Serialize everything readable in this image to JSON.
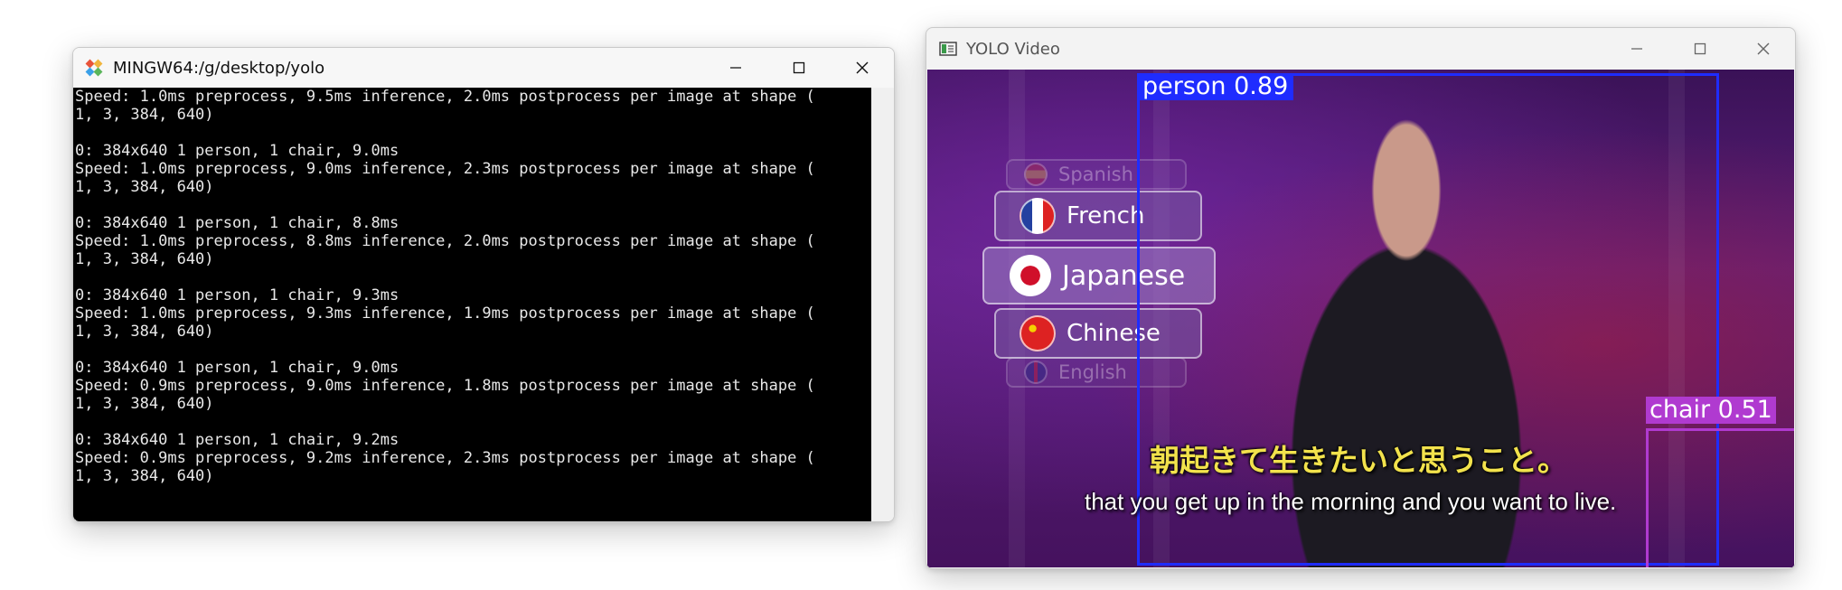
{
  "terminal": {
    "title": "MINGW64:/g/desktop/yolo",
    "lines": [
      "Speed: 1.0ms preprocess, 9.5ms inference, 2.0ms postprocess per image at shape (",
      "1, 3, 384, 640)",
      "",
      "0: 384x640 1 person, 1 chair, 9.0ms",
      "Speed: 1.0ms preprocess, 9.0ms inference, 2.3ms postprocess per image at shape (",
      "1, 3, 384, 640)",
      "",
      "0: 384x640 1 person, 1 chair, 8.8ms",
      "Speed: 1.0ms preprocess, 8.8ms inference, 2.0ms postprocess per image at shape (",
      "1, 3, 384, 640)",
      "",
      "0: 384x640 1 person, 1 chair, 9.3ms",
      "Speed: 1.0ms preprocess, 9.3ms inference, 1.9ms postprocess per image at shape (",
      "1, 3, 384, 640)",
      "",
      "0: 384x640 1 person, 1 chair, 9.0ms",
      "Speed: 0.9ms preprocess, 9.0ms inference, 1.8ms postprocess per image at shape (",
      "1, 3, 384, 640)",
      "",
      "0: 384x640 1 person, 1 chair, 9.2ms",
      "Speed: 0.9ms preprocess, 9.2ms inference, 2.3ms postprocess per image at shape (",
      "1, 3, 384, 640)"
    ],
    "icon": "git-bash-icon"
  },
  "video": {
    "title": "YOLO Video",
    "icon": "opencv-window-icon",
    "detections": {
      "person": {
        "label": "person 0.89",
        "color": "#1f2cff"
      },
      "chair": {
        "label": "chair 0.51",
        "color": "#b03ad0"
      }
    },
    "languages": [
      {
        "name": "Spanish"
      },
      {
        "name": "French"
      },
      {
        "name": "Japanese"
      },
      {
        "name": "Chinese"
      },
      {
        "name": "English"
      }
    ],
    "subtitle_jp": "朝起きて生きたいと思うこと。",
    "subtitle_en": "that you get up in the morning and you want to live."
  },
  "window_controls": [
    "minimize-icon",
    "maximize-icon",
    "close-icon"
  ]
}
